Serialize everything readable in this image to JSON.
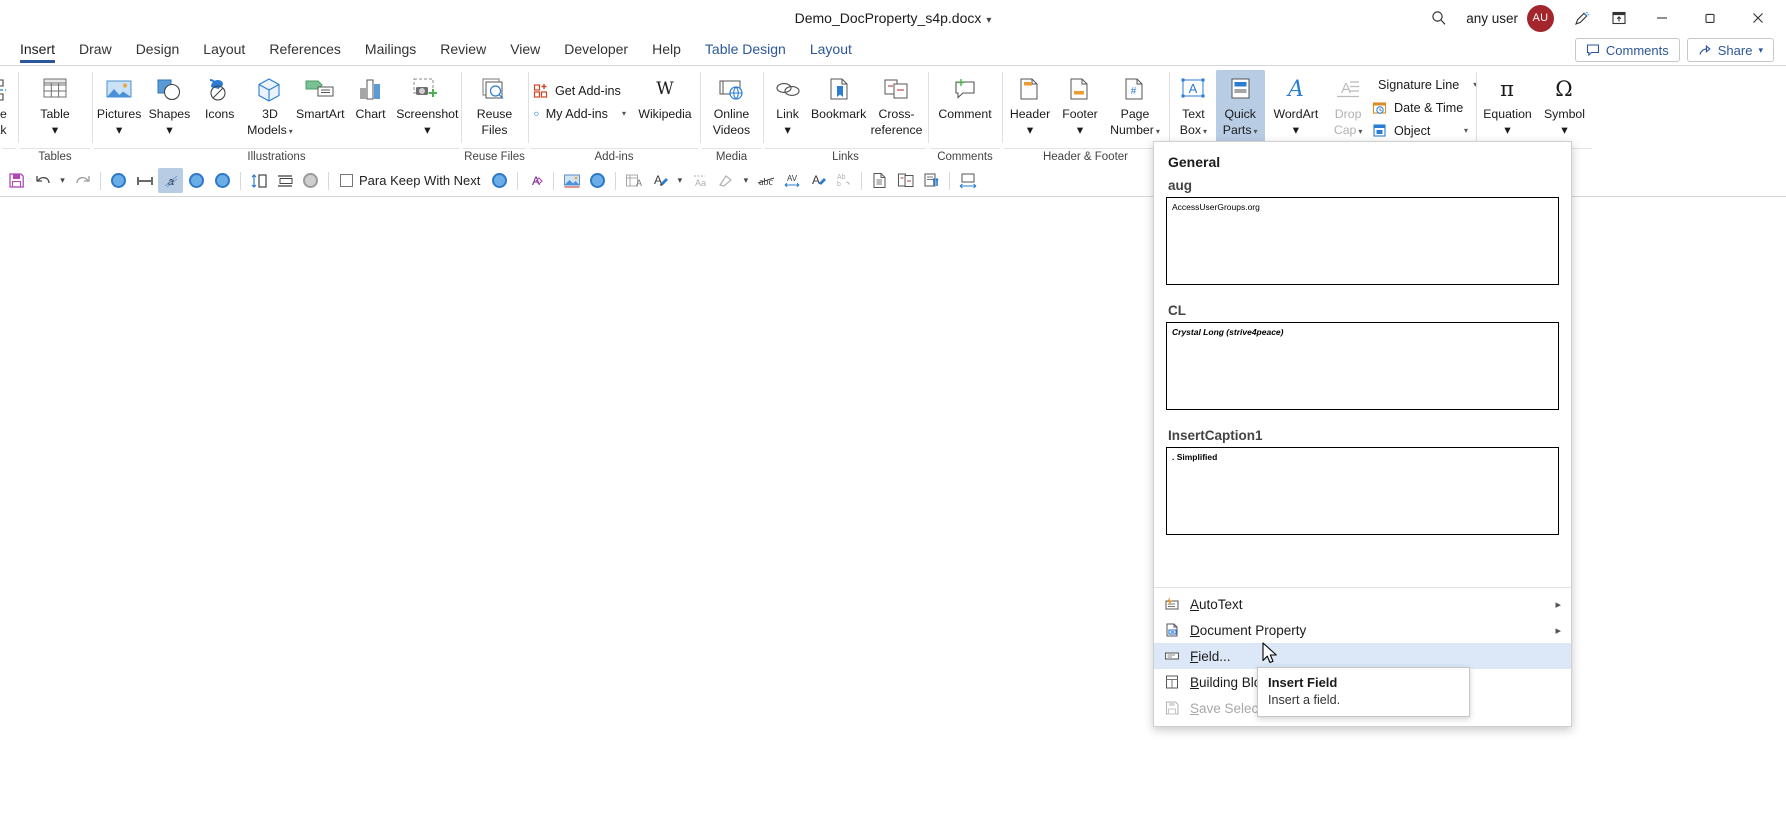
{
  "window": {
    "title": "Demo_DocProperty_s4p.docx",
    "title_chevron": "chevron-down",
    "search_icon": "search-icon",
    "user_name": "any user",
    "user_initials": "AU",
    "pen_icon": "pen-icon",
    "ribbon_display_icon": "ribbon-display-options-icon",
    "minimize": "minimize-icon",
    "restore": "restore-icon",
    "close": "close-icon"
  },
  "tabs": {
    "items": [
      {
        "label": "Insert",
        "active": true,
        "contextual": false
      },
      {
        "label": "Draw",
        "active": false,
        "contextual": false
      },
      {
        "label": "Design",
        "active": false,
        "contextual": false
      },
      {
        "label": "Layout",
        "active": false,
        "contextual": false
      },
      {
        "label": "References",
        "active": false,
        "contextual": false
      },
      {
        "label": "Mailings",
        "active": false,
        "contextual": false
      },
      {
        "label": "Review",
        "active": false,
        "contextual": false
      },
      {
        "label": "View",
        "active": false,
        "contextual": false
      },
      {
        "label": "Developer",
        "active": false,
        "contextual": false
      },
      {
        "label": "Help",
        "active": false,
        "contextual": false
      },
      {
        "label": "Table Design",
        "active": false,
        "contextual": true
      },
      {
        "label": "Layout",
        "active": false,
        "contextual": true
      }
    ],
    "comments_label": "Comments",
    "share_label": "Share"
  },
  "ribbon": {
    "groups": [
      {
        "name": "Pages",
        "label": "",
        "items": [
          {
            "label": "ge",
            "sub": "ak",
            "icon": "page-break-icon"
          }
        ]
      },
      {
        "name": "Tables",
        "label": "Tables",
        "items": [
          {
            "label": "Table",
            "sub": "",
            "icon": "table-icon",
            "dropdown": true
          }
        ]
      },
      {
        "name": "Illustrations",
        "label": "Illustrations",
        "items": [
          {
            "label": "Pictures",
            "sub": "",
            "icon": "pictures-icon",
            "dropdown": true
          },
          {
            "label": "Shapes",
            "sub": "",
            "icon": "shapes-icon",
            "dropdown": true
          },
          {
            "label": "Icons",
            "sub": "",
            "icon": "icons-icon",
            "dropdown": false
          },
          {
            "label": "3D",
            "sub": "Models",
            "icon": "3d-models-icon",
            "dropdown": true
          },
          {
            "label": "SmartArt",
            "sub": "",
            "icon": "smartart-icon",
            "dropdown": false
          },
          {
            "label": "Chart",
            "sub": "",
            "icon": "chart-icon",
            "dropdown": false
          },
          {
            "label": "Screenshot",
            "sub": "",
            "icon": "screenshot-icon",
            "dropdown": true
          }
        ]
      },
      {
        "name": "Reuse Files",
        "label": "Reuse Files",
        "items": [
          {
            "label": "Reuse",
            "sub": "Files",
            "icon": "reuse-files-icon",
            "dropdown": false
          }
        ]
      },
      {
        "name": "Add-ins",
        "label": "Add-ins",
        "small_items": [
          {
            "label": "Get Add-ins",
            "icon": "get-addins-icon",
            "chevron": false
          },
          {
            "label": "My Add-ins",
            "icon": "my-addins-icon",
            "chevron": true
          }
        ],
        "items": [
          {
            "label": "Wikipedia",
            "sub": "",
            "icon": "wikipedia-icon",
            "dropdown": false
          }
        ]
      },
      {
        "name": "Media",
        "label": "Media",
        "items": [
          {
            "label": "Online",
            "sub": "Videos",
            "icon": "online-video-icon",
            "dropdown": false
          }
        ]
      },
      {
        "name": "Links",
        "label": "Links",
        "items": [
          {
            "label": "Link",
            "sub": "",
            "icon": "link-icon",
            "dropdown": true
          },
          {
            "label": "Bookmark",
            "sub": "",
            "icon": "bookmark-icon",
            "dropdown": false
          },
          {
            "label": "Cross-",
            "sub": "reference",
            "icon": "cross-reference-icon",
            "dropdown": false
          }
        ]
      },
      {
        "name": "Comments",
        "label": "Comments",
        "items": [
          {
            "label": "Comment",
            "sub": "",
            "icon": "comment-icon",
            "dropdown": false
          }
        ]
      },
      {
        "name": "Header & Footer",
        "label": "Header & Footer",
        "items": [
          {
            "label": "Header",
            "sub": "",
            "icon": "header-icon",
            "dropdown": true
          },
          {
            "label": "Footer",
            "sub": "",
            "icon": "footer-icon",
            "dropdown": true
          },
          {
            "label": "Page",
            "sub": "Number",
            "icon": "page-number-icon",
            "dropdown": true
          }
        ]
      },
      {
        "name": "Text",
        "label": "",
        "items": [
          {
            "label": "Text",
            "sub": "Box",
            "icon": "text-box-icon",
            "dropdown": true
          },
          {
            "label": "Quick",
            "sub": "Parts",
            "icon": "quick-parts-icon",
            "dropdown": true,
            "selected": true
          },
          {
            "label": "WordArt",
            "sub": "",
            "icon": "wordart-icon",
            "dropdown": true
          },
          {
            "label": "Drop",
            "sub": "Cap",
            "icon": "drop-cap-icon",
            "dropdown": true,
            "disabled": true
          }
        ],
        "small_items": [
          {
            "label": "Signature Line",
            "icon": "signature-line-icon",
            "chevron": true
          },
          {
            "label": "Date & Time",
            "icon": "date-time-icon",
            "chevron": false
          },
          {
            "label": "Object",
            "icon": "object-icon",
            "chevron": true
          }
        ]
      },
      {
        "name": "Symbols",
        "label": "",
        "items": [
          {
            "label": "Equation",
            "sub": "",
            "icon": "equation-icon",
            "dropdown": true
          },
          {
            "label": "Symbol",
            "sub": "",
            "icon": "symbol-icon",
            "dropdown": true
          }
        ]
      }
    ]
  },
  "toolbar2": {
    "checkbox_label": "Para Keep With Next",
    "icons": [
      "save-icon",
      "undo-icon",
      "undo-dropdown",
      "redo-icon",
      "sep",
      "macro-circle-1-icon",
      "spacing-icon",
      "highlight-a-icon",
      "macro-circle-2-icon",
      "macro-circle-3-icon",
      "sep",
      "line-spacing-icon",
      "paragraph-indent-icon",
      "macro-circle-grey-icon",
      "sep",
      "para-keep-with-next-checkbox",
      "macro-circle-4-icon",
      "sep",
      "clear-formatting-icon",
      "sep",
      "insert-picture-icon",
      "macro-circle-5-icon",
      "sep",
      "table-properties-icon",
      "format-painter-icon",
      "format-painter-dropdown",
      "change-case-icon",
      "pen-tool-icon",
      "pen-tool-dropdown",
      "strikethrough-abc-icon",
      "character-spacing-icon",
      "text-effects-icon",
      "replace-icon",
      "sep",
      "document-icon",
      "compare-docs-icon",
      "doc-tools-icon",
      "sep",
      "fit-width-icon"
    ]
  },
  "quick_parts_menu": {
    "category": "General",
    "gallery": [
      {
        "name": "aug",
        "preview": "AccessUserGroups.org",
        "preview_style": "plain"
      },
      {
        "name": "CL",
        "preview": "Crystal Long (strive4peace)",
        "preview_style": "bold-italic"
      },
      {
        "name": "InsertCaption1",
        "preview": ". Simplified",
        "preview_style": "bold"
      }
    ],
    "items": [
      {
        "label": "AutoText",
        "accel": "A",
        "icon": "autotext-icon",
        "submenu": true,
        "disabled": false,
        "highlighted": false
      },
      {
        "label": "Document Property",
        "accel": "D",
        "icon": "document-property-icon",
        "submenu": true,
        "disabled": false,
        "highlighted": false
      },
      {
        "label": "Field...",
        "accel": "F",
        "icon": "field-icon",
        "submenu": false,
        "disabled": false,
        "highlighted": true
      },
      {
        "label": "Building Blocks Organizer...",
        "accel": "B",
        "icon": "building-blocks-icon",
        "submenu": false,
        "disabled": false,
        "highlighted": false
      },
      {
        "label": "Save Selection to Quick Part Gallery...",
        "accel": "S",
        "icon": "save-selection-icon",
        "submenu": false,
        "disabled": true,
        "highlighted": false
      }
    ]
  },
  "tooltip": {
    "title": "Insert Field",
    "body": "Insert a field."
  },
  "colors": {
    "accent": "#2b579a",
    "selection": "#b8cce4",
    "highlight": "#dce8f7",
    "avatar": "#a4262c"
  }
}
